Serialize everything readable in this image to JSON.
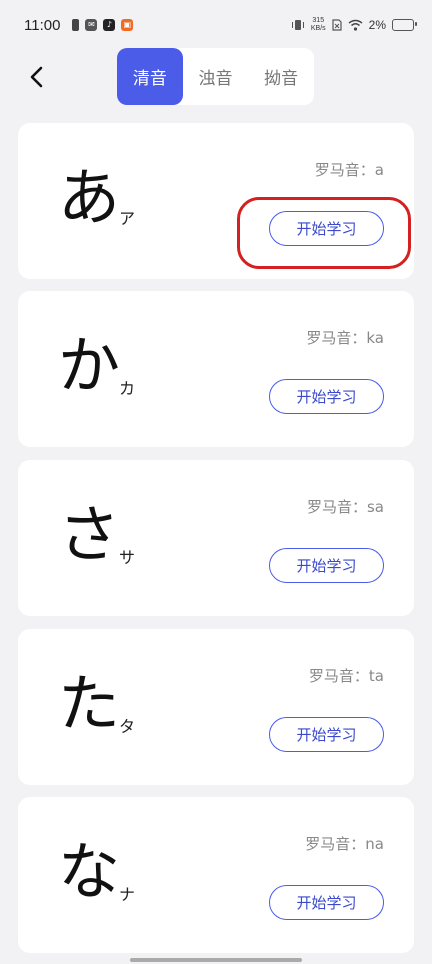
{
  "status_bar": {
    "time": "11:00",
    "net_speed_top": "315",
    "net_speed_bottom": "KB/s",
    "battery_text": "2%"
  },
  "tabs": [
    {
      "label": "清音",
      "active": true
    },
    {
      "label": "浊音",
      "active": false
    },
    {
      "label": "拗音",
      "active": false
    }
  ],
  "cards": [
    {
      "hiragana": "あ",
      "katakana": "ア",
      "romaji": "罗马音：a",
      "button": "开始学习"
    },
    {
      "hiragana": "か",
      "katakana": "カ",
      "romaji": "罗马音：ka",
      "button": "开始学习"
    },
    {
      "hiragana": "さ",
      "katakana": "サ",
      "romaji": "罗马音：sa",
      "button": "开始学习"
    },
    {
      "hiragana": "た",
      "katakana": "タ",
      "romaji": "罗马音：ta",
      "button": "开始学习"
    },
    {
      "hiragana": "な",
      "katakana": "ナ",
      "romaji": "罗马音：na",
      "button": "开始学习"
    }
  ],
  "colors": {
    "accent": "#4a5ce8",
    "highlight": "#d42020",
    "background": "#f2f2f4"
  },
  "icons": [
    "back-icon",
    "battery-saver-icon",
    "mail-icon",
    "tiktok-icon",
    "shop-icon",
    "vibrate-icon",
    "sim-icon",
    "wifi-icon",
    "battery-icon"
  ]
}
